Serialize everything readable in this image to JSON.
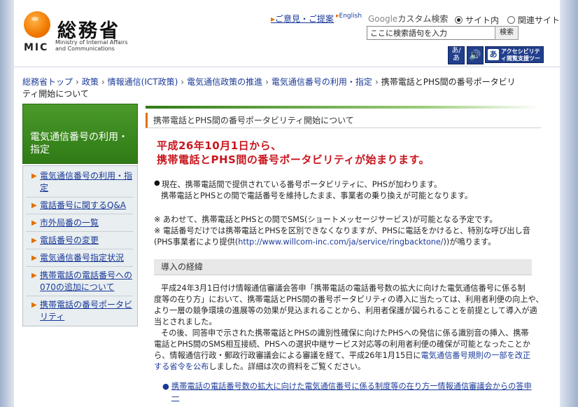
{
  "header": {
    "logo_name": "総務省",
    "logo_abbr": "MIC",
    "logo_english": "Ministry of Internal Affairs and Communications",
    "feedback_link": "ご意見・ご提案",
    "english_link": "English",
    "google_brand": "Google",
    "google_label": "カスタム検索",
    "radio_site": "サイト内",
    "radio_related": "関連サイト",
    "search_value": "ここに検索語句を入力",
    "search_button": "検索",
    "tool_kana": "あ/あ",
    "tool_voice_glyph": "あ",
    "tool_access_icon": "あ",
    "tool_access_label": "アクセシビリティ閲覧支援ツール"
  },
  "breadcrumb": {
    "items": [
      "総務省トップ",
      "政策",
      "情報通信(ICT政策)",
      "電気通信政策の推進",
      "電気通信番号の利用・指定"
    ],
    "current": "携帯電話とPHS間の番号ポータビリティ開始について"
  },
  "sidebar": {
    "heading": "電気通信番号の利用・指定",
    "items": [
      {
        "label": "電気通信番号の利用・指定"
      },
      {
        "label": "電話番号に関するQ&A"
      },
      {
        "label": "市外局番の一覧"
      },
      {
        "label": "電話番号の変更"
      },
      {
        "label": "電気通信番号指定状況"
      },
      {
        "label": "携帯電話の電話番号への070の追加について"
      },
      {
        "label": "携帯電話の番号ポータビリティ"
      }
    ]
  },
  "main": {
    "title": "携帯電話とPHS間の番号ポータビリティ開始について",
    "announce_line1": "平成26年10月1日から、",
    "announce_line2": "携帯電話とPHS間の番号ポータビリティが始まります。",
    "bullet_symbol": "●",
    "p1_line1": "現在、携帯電話間で提供されている番号ポータビリティに、PHSが加わります。",
    "p1_line2": "携帯電話とPHSとの間で電話番号を維持したまま、事業者の乗り換えが可能となります。",
    "note1": "※ あわせて、携帯電話とPHSとの間でSMS(ショートメッセージサービス)が可能となる予定です。",
    "note2_line1": "※ 電話番号だけでは携帯電話とPHSを区別できなくなりますが、PHSに電話をかけると、特別な呼び出し音",
    "note2_prefix": "(PHS事業者により提供(",
    "note2_url": "http://www.willcom-inc.com/ja/service/ringbacktone/",
    "note2_suffix": "))が鳴ります。",
    "section_heading": "導入の経緯",
    "para1": [
      "平成24年3月1日付け情報通信審議会答申「携帯電話の電話番号数の拡大に向けた電気通信番号に係る制",
      "度等の在り方」において、携帯電話とPHS間の番号ポータビリティの導入に当たっては、利用者利便の向上や、",
      "より一層の競争環境の進展等の効果が見込まれることから、利用者保護が図られることを前提として導入が適",
      "当とされました。"
    ],
    "para2_lines": [
      "その後、同答申で示された携帯電話とPHSの識別性確保に向けたPHSへの発信に係る識別音の挿入、携帯",
      "電話とPHS間のSMS相互接続、PHSへの選択中継サービス対応等の利用者利便の確保が可能となったことか"
    ],
    "para2_line3_pre": "ら、情報通信行政・郵政行政審議会による審議を経て、平成26年1月15日に",
    "para2_link_a": "電気通信番号規則の一部を改正",
    "para2_link_b": "する省令を公布",
    "para2_line4_post": "しました。詳細は次の資料をご覧ください。",
    "link_bullet": "●",
    "doc_link": "携帯電話の電話番号数の拡大に向けた電気通信番号に係る制度等の在り方一情報通信審議会からの答申一"
  },
  "colors": {
    "accent_orange": "#e07000",
    "sidebar_green": "#3e8b22",
    "announce_red": "#c8161e",
    "link_blue": "#1a3a99",
    "tool_navy": "#223f8c"
  }
}
